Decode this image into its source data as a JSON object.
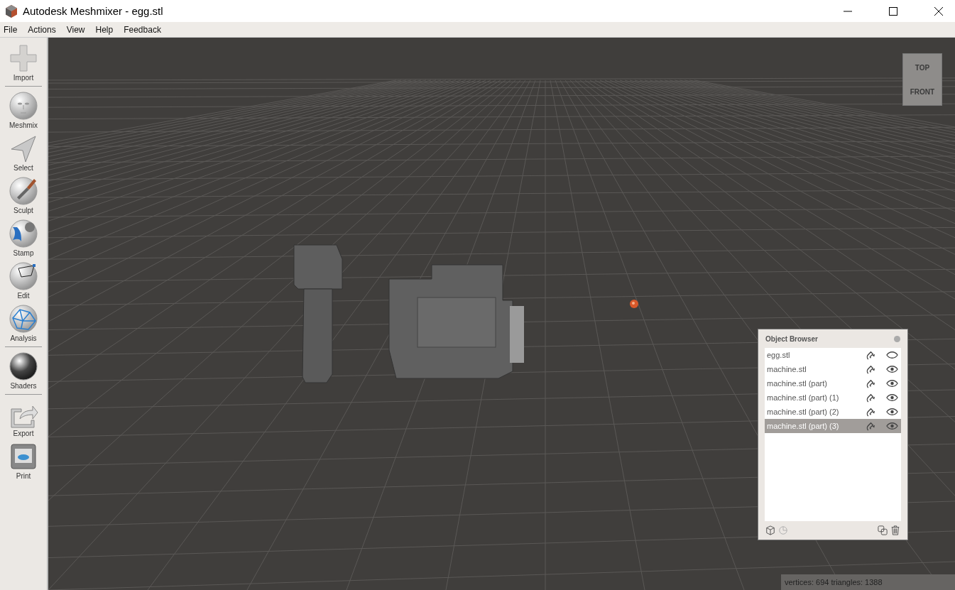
{
  "window": {
    "title": "Autodesk Meshmixer - egg.stl"
  },
  "menu": [
    "File",
    "Actions",
    "View",
    "Help",
    "Feedback"
  ],
  "tools": [
    {
      "kind": "import",
      "label": "Import"
    },
    {
      "kind": "separator"
    },
    {
      "kind": "meshmix",
      "label": "Meshmix"
    },
    {
      "kind": "select",
      "label": "Select"
    },
    {
      "kind": "sculpt",
      "label": "Sculpt"
    },
    {
      "kind": "stamp",
      "label": "Stamp"
    },
    {
      "kind": "edit",
      "label": "Edit"
    },
    {
      "kind": "analysis",
      "label": "Analysis"
    },
    {
      "kind": "separator"
    },
    {
      "kind": "shaders",
      "label": "Shaders"
    },
    {
      "kind": "separator"
    },
    {
      "kind": "export",
      "label": "Export"
    },
    {
      "kind": "print",
      "label": "Print"
    }
  ],
  "view_cube": {
    "top": "TOP",
    "front": "FRONT"
  },
  "object_browser": {
    "title": "Object Browser",
    "items": [
      {
        "name": "egg.stl",
        "visible": false,
        "selected": false
      },
      {
        "name": "machine.stl",
        "visible": true,
        "selected": false
      },
      {
        "name": "machine.stl (part)",
        "visible": true,
        "selected": false
      },
      {
        "name": "machine.stl (part) (1)",
        "visible": true,
        "selected": false
      },
      {
        "name": "machine.stl (part) (2)",
        "visible": true,
        "selected": false
      },
      {
        "name": "machine.stl (part) (3)",
        "visible": true,
        "selected": true
      }
    ]
  },
  "status_bar": "vertices: 694 triangles: 1388"
}
